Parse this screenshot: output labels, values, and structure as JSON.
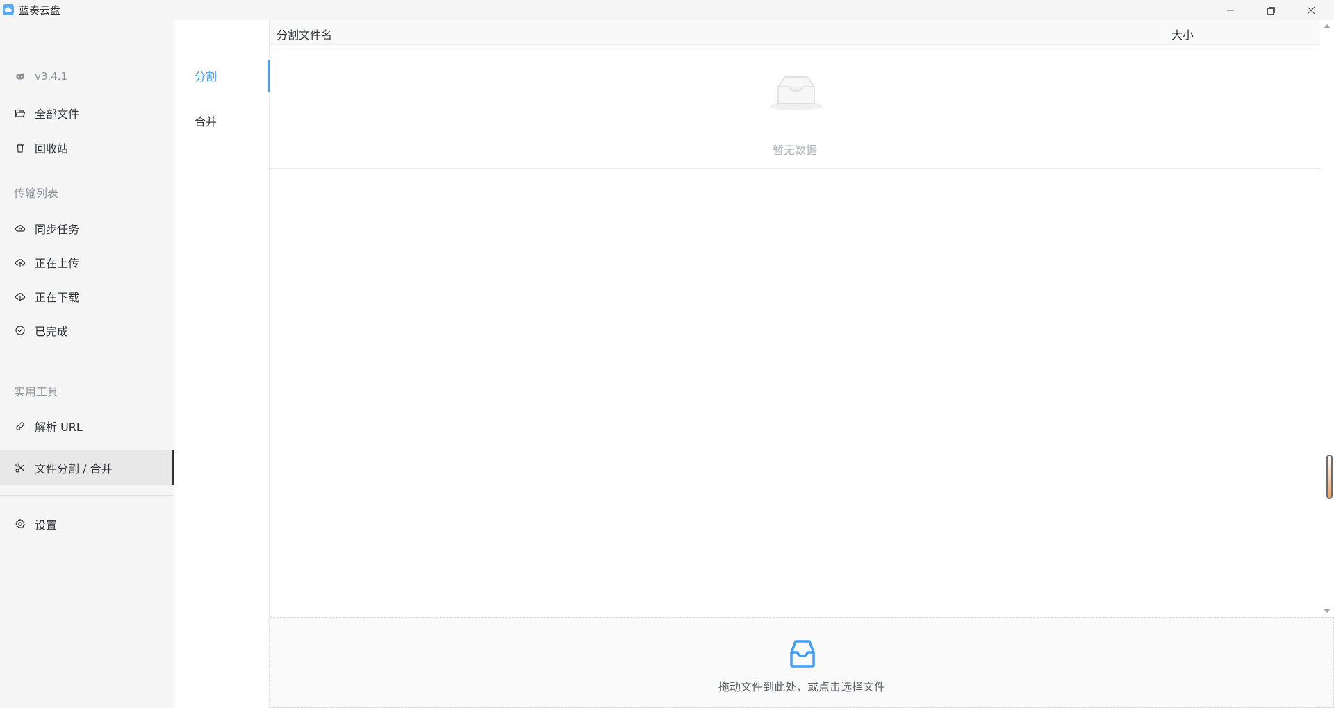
{
  "window": {
    "title": "蓝奏云盘",
    "controls": [
      "minimize-icon",
      "restore-icon",
      "close-icon"
    ]
  },
  "sidebar": {
    "version": "v3.4.1",
    "items_top": [
      {
        "label": "全部文件",
        "icon": "folder-open-icon"
      },
      {
        "label": "回收站",
        "icon": "trash-icon"
      }
    ],
    "group_transfer": "传输列表",
    "items_transfer": [
      {
        "label": "同步任务",
        "icon": "cloud-sync-icon"
      },
      {
        "label": "正在上传",
        "icon": "cloud-upload-icon"
      },
      {
        "label": "正在下载",
        "icon": "cloud-download-icon"
      },
      {
        "label": "已完成",
        "icon": "check-circle-icon"
      }
    ],
    "group_tools": "实用工具",
    "items_tools": [
      {
        "label": "解析 URL",
        "icon": "link-icon"
      },
      {
        "label": "文件分割 / 合并",
        "icon": "scissors-icon",
        "active": true
      }
    ],
    "settings": {
      "label": "设置",
      "icon": "gear-icon"
    }
  },
  "subtabs": [
    {
      "label": "分割",
      "active": true
    },
    {
      "label": "合并",
      "active": false
    }
  ],
  "table": {
    "columns": [
      "分割文件名",
      "大小"
    ],
    "rows": [],
    "empty_text": "暂无数据"
  },
  "dropzone": {
    "text": "拖动文件到此处，或点击选择文件",
    "icon": "inbox-icon"
  },
  "colors": {
    "accent": "#409eff",
    "sidebar_bg": "#f5f5f5",
    "active_bg": "#e8e8e8",
    "muted_text": "#909399"
  }
}
